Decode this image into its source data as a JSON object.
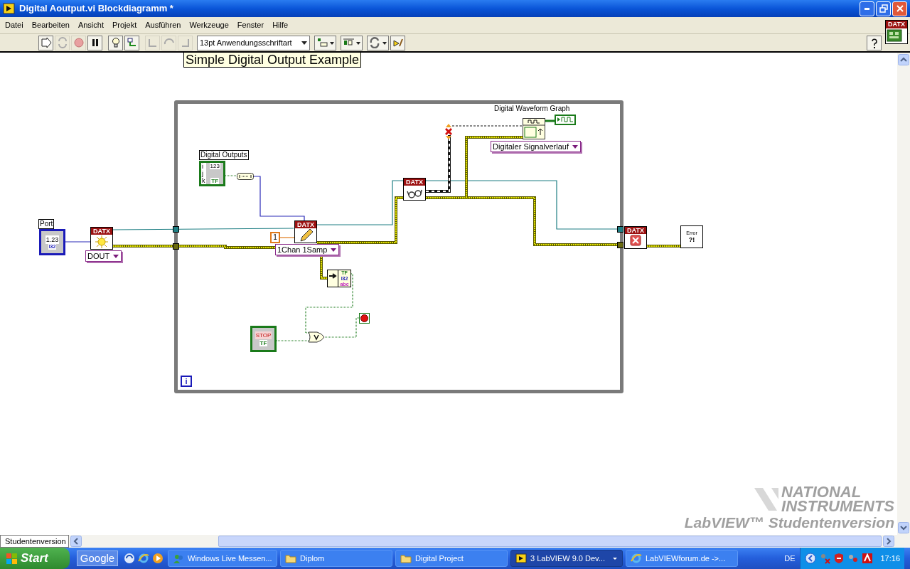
{
  "window": {
    "title": "Digital Aoutput.vi Blockdiagramm *"
  },
  "menu": [
    "Datei",
    "Bearbeiten",
    "Ansicht",
    "Projekt",
    "Ausführen",
    "Werkzeuge",
    "Fenster",
    "Hilfe"
  ],
  "toolbar": {
    "font": "13pt Anwendungsschriftart"
  },
  "palette_badge": {
    "header": "DATX"
  },
  "diagram": {
    "comment": "Simple Digital Output Example",
    "port": {
      "label": "Port",
      "value": "1.23",
      "type": "I32"
    },
    "create_node": {
      "header": "DATX",
      "ring": "DOUT"
    },
    "digital_outputs": {
      "label": "Digital Outputs",
      "value": "123",
      "indices": [
        "i",
        "j",
        "k"
      ],
      "type": "TF"
    },
    "write_node": {
      "header": "DATX",
      "constant": "1",
      "ring": "1Chan 1Samp"
    },
    "read_node": {
      "header": "DATX"
    },
    "graph": {
      "label": "Digital Waveform Graph",
      "ring": "Digitaler Signalverlauf"
    },
    "clear_node": {
      "header": "DATX"
    },
    "unbundle": {
      "types": [
        "TF",
        "I32",
        "abc"
      ]
    },
    "stop_button": {
      "text": "STOP",
      "type": "TF"
    },
    "error_handler": {
      "text": "Error",
      "mark": "?!"
    },
    "loop": {
      "iteration": "i"
    }
  },
  "watermark": {
    "brand_1": "NATIONAL",
    "brand_2": "INSTRUMENTS",
    "product": "LabVIEW™ Studentenversion"
  },
  "status_bar": {
    "label": "Studentenversion"
  },
  "taskbar": {
    "start": "Start",
    "search": "Google",
    "items": [
      {
        "kind": "messenger",
        "label": "Windows Live Messen...",
        "selected": false
      },
      {
        "kind": "folder",
        "label": "Diplom",
        "selected": false
      },
      {
        "kind": "folder",
        "label": "Digital Project",
        "selected": false
      },
      {
        "kind": "labview",
        "label": "3 LabVIEW 9.0 Dev...",
        "selected": true
      },
      {
        "kind": "browser",
        "label": "LabVIEWforum.de ->...",
        "selected": false
      }
    ],
    "language": "DE",
    "clock": "17:16"
  }
}
